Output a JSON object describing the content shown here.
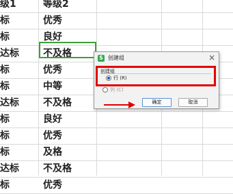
{
  "sheet": {
    "header": {
      "col1": "级1",
      "col2": "等级2"
    },
    "rows": [
      {
        "col1": "标",
        "col2": "优秀"
      },
      {
        "col1": "标",
        "col2": "良好"
      },
      {
        "col1": "达标",
        "col2": "不及格"
      },
      {
        "col1": "标",
        "col2": "优秀"
      },
      {
        "col1": "标",
        "col2": "中等"
      },
      {
        "col1": "达标",
        "col2": "不及格"
      },
      {
        "col1": "标",
        "col2": "良好"
      },
      {
        "col1": "标",
        "col2": "优秀"
      },
      {
        "col1": "标",
        "col2": "及格"
      },
      {
        "col1": "达标",
        "col2": "不及格"
      },
      {
        "col1": "标",
        "col2": "优秀"
      }
    ]
  },
  "dialog": {
    "app_icon_letter": "S",
    "title": "创建组",
    "close_label": "×",
    "group_label": "创建组",
    "option_row": "行 (R)",
    "option_col": "列 (C)",
    "ok_label": "确定",
    "cancel_label": "取消"
  },
  "colors": {
    "selection_border": "#3aa13a",
    "highlight_box": "#e00000",
    "arrow": "#e00000"
  }
}
